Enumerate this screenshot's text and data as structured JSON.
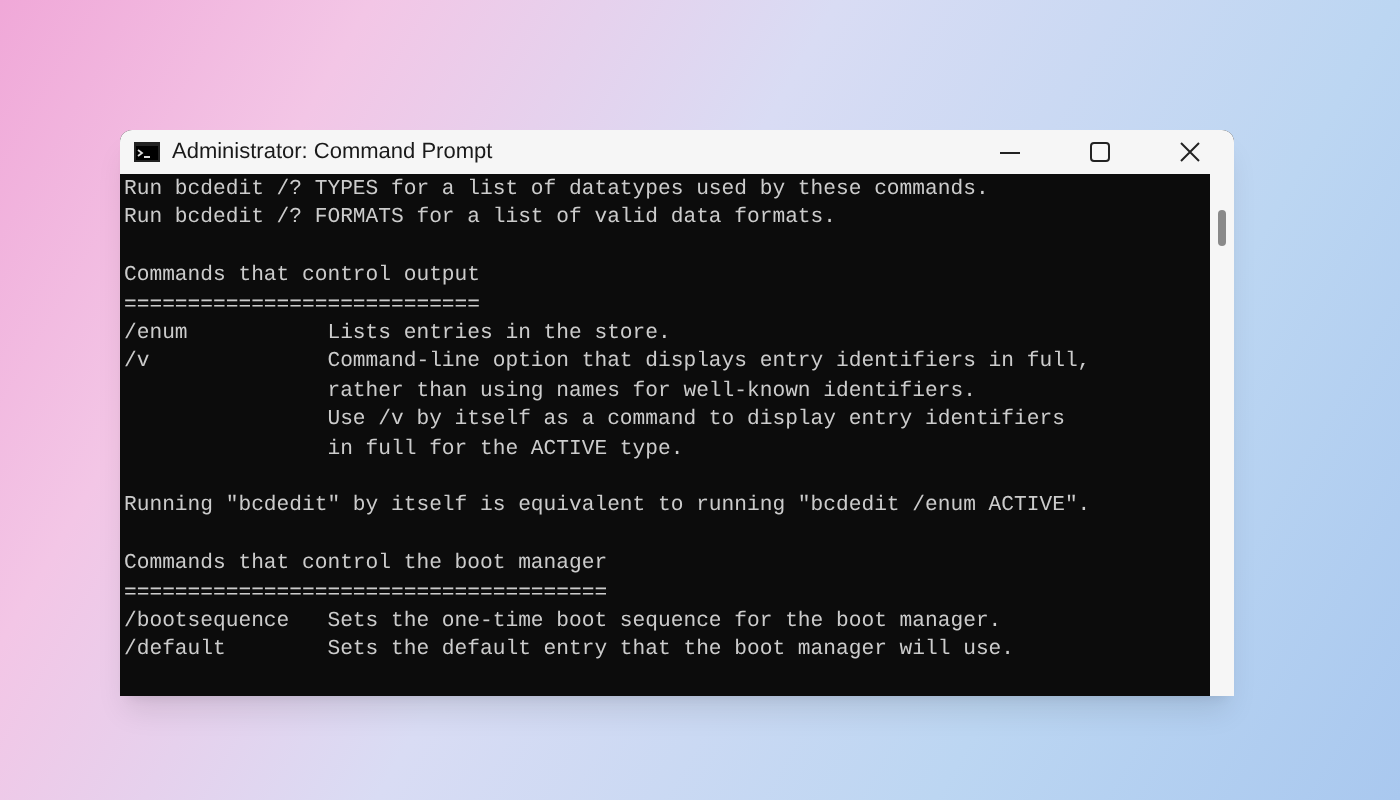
{
  "window": {
    "title": "Administrator: Command Prompt"
  },
  "console": {
    "lines": [
      {
        "kind": "text",
        "text": "Run bcdedit /? TYPES for a list of datatypes used by these commands."
      },
      {
        "kind": "text",
        "text": "Run bcdedit /? FORMATS for a list of valid data formats."
      },
      {
        "kind": "blank"
      },
      {
        "kind": "text",
        "text": "Commands that control output"
      },
      {
        "kind": "text",
        "text": "============================"
      },
      {
        "kind": "text",
        "text": "/enum           Lists entries in the store."
      },
      {
        "kind": "text",
        "text": "/v              Command-line option that displays entry identifiers in full,"
      },
      {
        "kind": "text",
        "text": "                rather than using names for well-known identifiers."
      },
      {
        "kind": "text",
        "text": "                Use /v by itself as a command to display entry identifiers"
      },
      {
        "kind": "text",
        "text": "                in full for the ACTIVE type."
      },
      {
        "kind": "blank"
      },
      {
        "kind": "text",
        "text": "Running \"bcdedit\" by itself is equivalent to running \"bcdedit /enum ACTIVE\"."
      },
      {
        "kind": "blank"
      },
      {
        "kind": "text",
        "text": "Commands that control the boot manager"
      },
      {
        "kind": "text",
        "text": "======================================"
      },
      {
        "kind": "text",
        "text": "/bootsequence   Sets the one-time boot sequence for the boot manager."
      },
      {
        "kind": "text",
        "text": "/default        Sets the default entry that the boot manager will use."
      }
    ]
  }
}
